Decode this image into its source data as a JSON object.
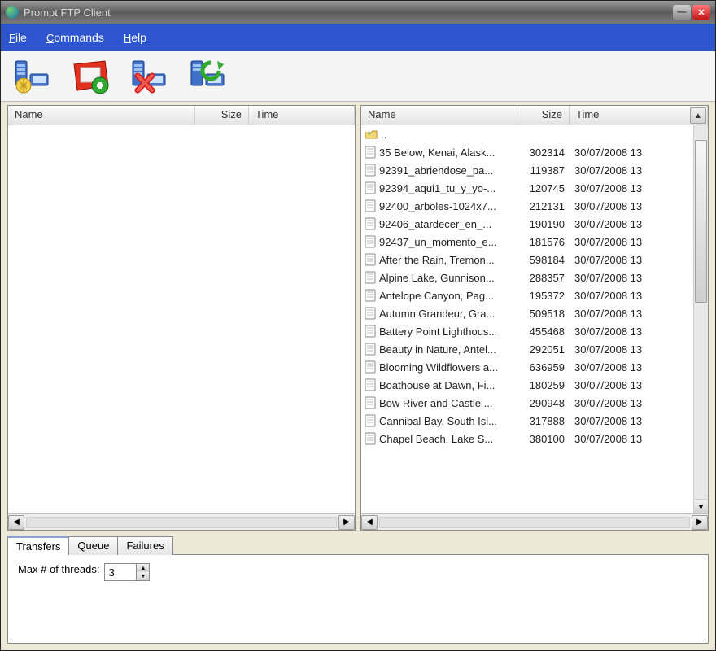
{
  "title": "Prompt FTP Client",
  "menus": {
    "file": "File",
    "commands": "Commands",
    "help": "Help"
  },
  "toolbar_icons": {
    "connect": "connect-icon",
    "bookmark": "add-bookmark-icon",
    "disconnect": "disconnect-icon",
    "refresh": "refresh-icon"
  },
  "columns": {
    "name": "Name",
    "size": "Size",
    "time": "Time"
  },
  "local_files": [],
  "remote_up": "..",
  "remote_files": [
    {
      "name": "35 Below, Kenai, Alask...",
      "size": "302314",
      "time": "30/07/2008 13"
    },
    {
      "name": "92391_abriendose_pa...",
      "size": "119387",
      "time": "30/07/2008 13"
    },
    {
      "name": "92394_aqui1_tu_y_yo-...",
      "size": "120745",
      "time": "30/07/2008 13"
    },
    {
      "name": "92400_arboles-1024x7...",
      "size": "212131",
      "time": "30/07/2008 13"
    },
    {
      "name": "92406_atardecer_en_...",
      "size": "190190",
      "time": "30/07/2008 13"
    },
    {
      "name": "92437_un_momento_e...",
      "size": "181576",
      "time": "30/07/2008 13"
    },
    {
      "name": "After the Rain, Tremon...",
      "size": "598184",
      "time": "30/07/2008 13"
    },
    {
      "name": "Alpine Lake, Gunnison...",
      "size": "288357",
      "time": "30/07/2008 13"
    },
    {
      "name": "Antelope Canyon, Pag...",
      "size": "195372",
      "time": "30/07/2008 13"
    },
    {
      "name": "Autumn Grandeur, Gra...",
      "size": "509518",
      "time": "30/07/2008 13"
    },
    {
      "name": "Battery Point Lighthous...",
      "size": "455468",
      "time": "30/07/2008 13"
    },
    {
      "name": "Beauty in Nature, Antel...",
      "size": "292051",
      "time": "30/07/2008 13"
    },
    {
      "name": "Blooming Wildflowers a...",
      "size": "636959",
      "time": "30/07/2008 13"
    },
    {
      "name": "Boathouse at Dawn, Fi...",
      "size": "180259",
      "time": "30/07/2008 13"
    },
    {
      "name": "Bow River and Castle ...",
      "size": "290948",
      "time": "30/07/2008 13"
    },
    {
      "name": "Cannibal Bay, South Isl...",
      "size": "317888",
      "time": "30/07/2008 13"
    },
    {
      "name": "Chapel Beach, Lake S...",
      "size": "380100",
      "time": "30/07/2008 13"
    }
  ],
  "tabs": {
    "transfers": "Transfers",
    "queue": "Queue",
    "failures": "Failures"
  },
  "threads_label": "Max # of threads:",
  "threads_value": "3"
}
